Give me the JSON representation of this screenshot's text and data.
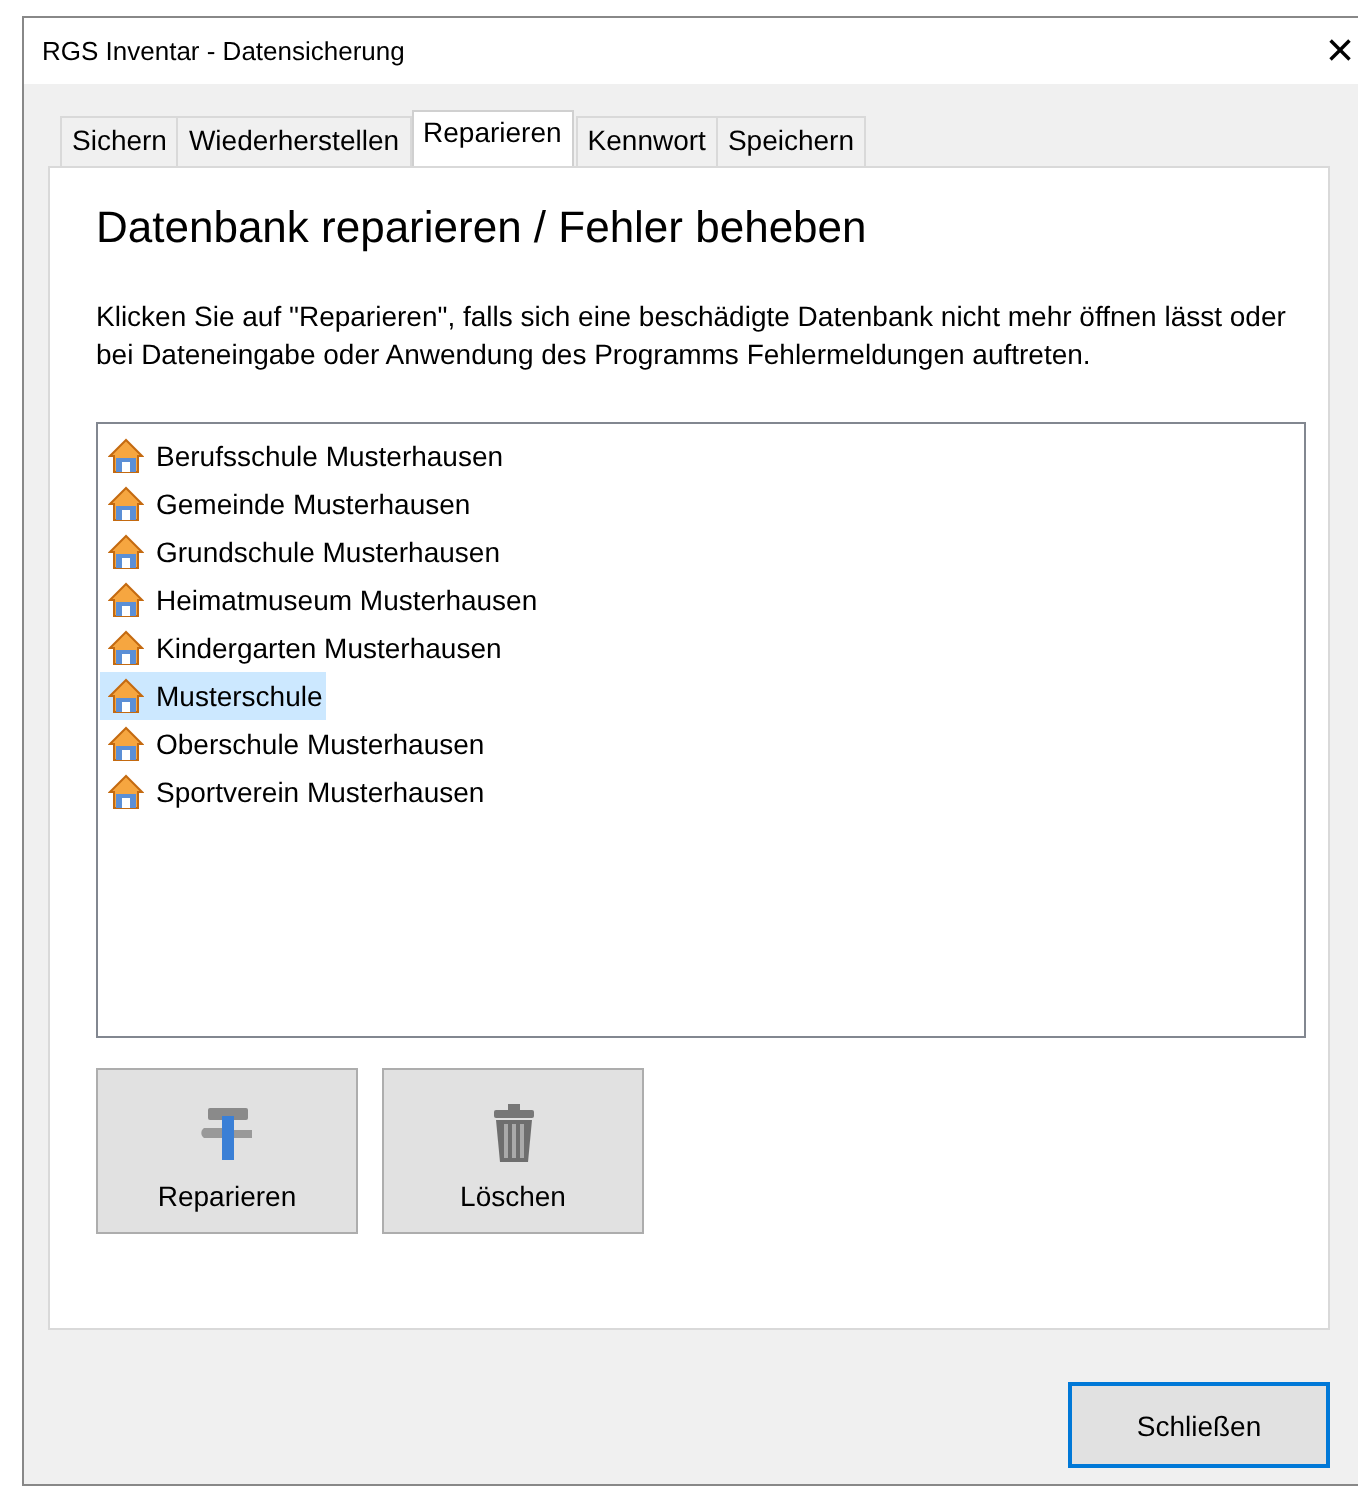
{
  "window": {
    "title": "RGS Inventar - Datensicherung",
    "close": "×"
  },
  "tabs": [
    {
      "label": "Sichern",
      "selected": false
    },
    {
      "label": "Wiederherstellen",
      "selected": false
    },
    {
      "label": "Reparieren",
      "selected": true
    },
    {
      "label": "Kennwort",
      "selected": false
    },
    {
      "label": "Speichern",
      "selected": false
    }
  ],
  "heading": "Datenbank reparieren / Fehler beheben",
  "description": "Klicken Sie auf \"Reparieren\", falls sich eine beschädigte Datenbank nicht mehr öffnen lässt oder bei Dateneingabe oder Anwendung des Programms Fehlermeldungen auftreten.",
  "databases": [
    {
      "name": "Berufsschule Musterhausen",
      "selected": false
    },
    {
      "name": "Gemeinde Musterhausen",
      "selected": false
    },
    {
      "name": "Grundschule Musterhausen",
      "selected": false
    },
    {
      "name": "Heimatmuseum Musterhausen",
      "selected": false
    },
    {
      "name": "Kindergarten Musterhausen",
      "selected": false
    },
    {
      "name": "Musterschule",
      "selected": true
    },
    {
      "name": "Oberschule Musterhausen",
      "selected": false
    },
    {
      "name": "Sportverein Musterhausen",
      "selected": false
    }
  ],
  "actions": [
    {
      "kind": "repair",
      "label": "Reparieren"
    },
    {
      "kind": "delete",
      "label": "Löschen"
    }
  ],
  "close_button": "Schließen"
}
